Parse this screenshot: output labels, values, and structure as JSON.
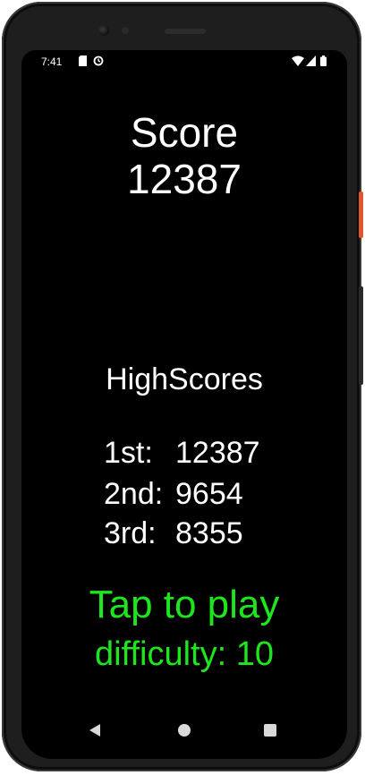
{
  "status_bar": {
    "time": "7:41",
    "left_icons": [
      "sd-card-icon",
      "sync-icon"
    ],
    "right_icons": [
      "wifi-icon",
      "signal-icon",
      "battery-icon"
    ]
  },
  "game": {
    "score_label": "Score",
    "score_value": "12387",
    "highscores_title": "HighScores",
    "highscores": [
      {
        "rank": "1st:",
        "score": "12387"
      },
      {
        "rank": "2nd:",
        "score": "9654"
      },
      {
        "rank": "3rd:",
        "score": "8355"
      }
    ],
    "tap_to_play": "Tap to play",
    "difficulty": "difficulty: 10",
    "accent_color": "#1ee61e"
  },
  "nav_bar": {
    "buttons": [
      "back-icon",
      "home-icon",
      "recents-icon"
    ]
  }
}
